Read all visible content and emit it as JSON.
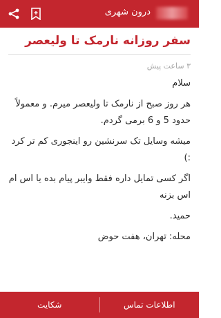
{
  "header": {
    "title": "درون شهری",
    "share_icon": "share-icon",
    "bookmark_icon": "bookmark-plus-icon",
    "accent_color": "#c3262e"
  },
  "post": {
    "title": "سفر روزانه نارمک تا ولیعصر",
    "timestamp": "۳ ساعت پیش",
    "paragraphs": [
      "سلام",
      "هر روز صبح از نارمک تا ولیعصر میرم. و معمولاً حدود 5 و 6 برمی گردم.",
      "میشه وسایل تک سرنشین رو اینجوری کم تر کرد :)",
      "اگر کسی تمایل داره فقط وایبر پیام بده یا اس ام اس بزنه",
      "حمید.",
      "محله: تهران، هفت حوض"
    ]
  },
  "footer": {
    "contact_label": "اطلاعات تماس",
    "report_label": "شکایت"
  }
}
